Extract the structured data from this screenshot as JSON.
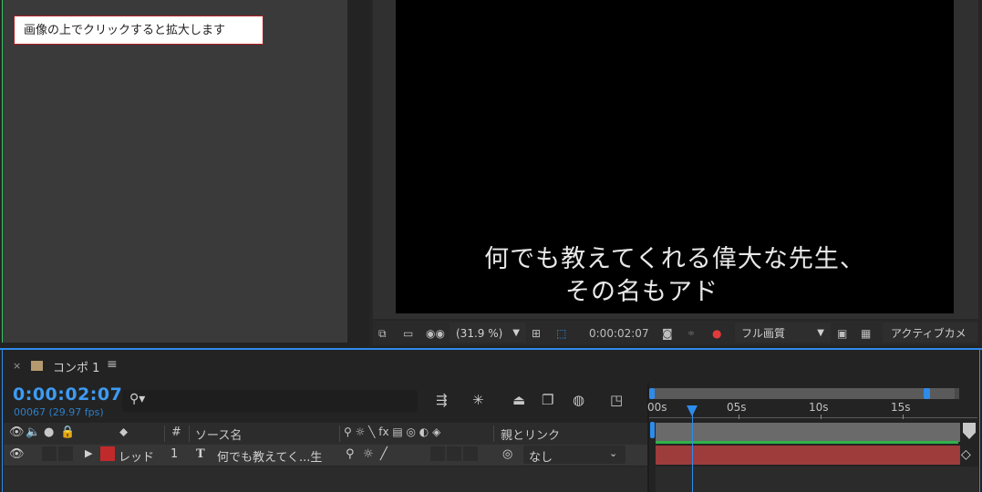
{
  "left_panel": {
    "note": "画像の上でクリックすると拡大します"
  },
  "viewer": {
    "subtitle_line1": "何でも教えてくれる偉大な先生、",
    "subtitle_line2": "その名もアド",
    "toolbar": {
      "zoom_value": "(31.9 %)",
      "current_time": "0:00:02:07",
      "resolution": "フル画質",
      "camera": "アクティブカメラ"
    }
  },
  "timeline": {
    "tab": {
      "close": "×",
      "name": "コンポ 1",
      "menu": "≡"
    },
    "timecode": "0:00:02:07",
    "frame_info": "00067 (29.97 fps)",
    "ruler": {
      "labels": [
        "00s",
        "05s",
        "10s",
        "15s"
      ]
    },
    "columns": {
      "number": "#",
      "source_name": "ソース名",
      "switches": "⚲ ☼ ╲ fx ▤ ◎ ◐ ◈",
      "parent_link": "親とリンク"
    },
    "layer": {
      "name": "レッド",
      "index": "1",
      "type": "T",
      "source": "何でも教えてく...生",
      "parent": "なし"
    }
  },
  "colors": {
    "accent_blue": "#2d8ceb",
    "layer_red": "#c02a2a",
    "layer_bar": "#9e3b3b",
    "work_area_green": "#2fb24a"
  }
}
